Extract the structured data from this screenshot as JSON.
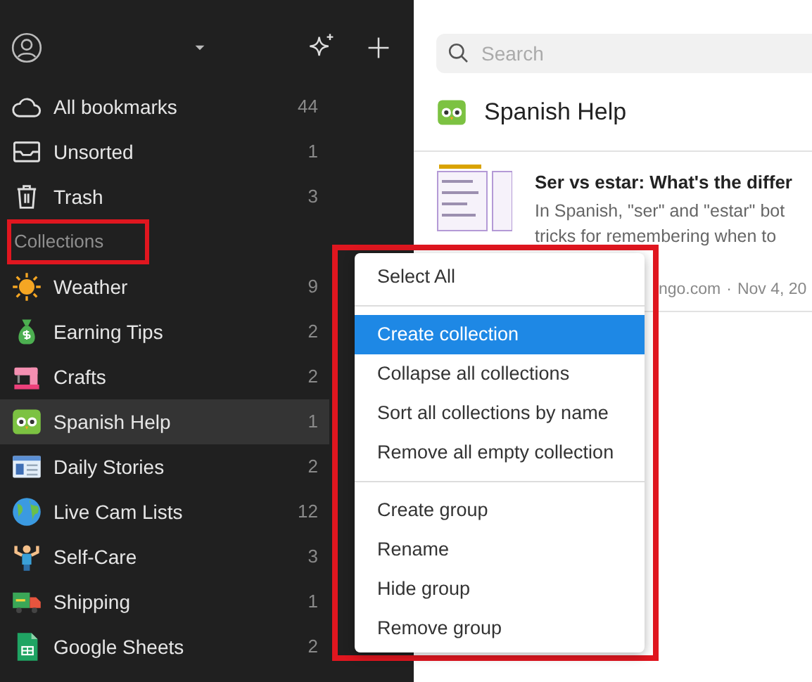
{
  "sidebar": {
    "system_items": [
      {
        "label": "All bookmarks",
        "count": "44"
      },
      {
        "label": "Unsorted",
        "count": "1"
      },
      {
        "label": "Trash",
        "count": "3"
      }
    ],
    "section_title": "Collections",
    "collections": [
      {
        "label": "Weather",
        "count": "9",
        "selected": false
      },
      {
        "label": "Earning Tips",
        "count": "2",
        "selected": false
      },
      {
        "label": "Crafts",
        "count": "2",
        "selected": false
      },
      {
        "label": "Spanish Help",
        "count": "1",
        "selected": true
      },
      {
        "label": "Daily Stories",
        "count": "2",
        "selected": false
      },
      {
        "label": "Live Cam Lists",
        "count": "12",
        "selected": false
      },
      {
        "label": "Self-Care",
        "count": "3",
        "selected": false
      },
      {
        "label": "Shipping",
        "count": "1",
        "selected": false
      },
      {
        "label": "Google Sheets",
        "count": "2",
        "selected": false
      }
    ]
  },
  "search": {
    "placeholder": "Search"
  },
  "collection_title": "Spanish Help",
  "bookmarks": [
    {
      "title": "Ser vs estar: What's the differ",
      "excerpt": [
        "In Spanish, \"ser\" and \"estar\" bot",
        "tricks for remembering when to"
      ],
      "source": "ngo.com",
      "separator": "·",
      "date": "Nov 4, 20"
    }
  ],
  "context_menu": {
    "groups": [
      [
        {
          "label": "Select All",
          "selected": false
        }
      ],
      [
        {
          "label": "Create collection",
          "selected": true
        },
        {
          "label": "Collapse all collections",
          "selected": false
        },
        {
          "label": "Sort all collections by name",
          "selected": false
        },
        {
          "label": "Remove all empty collection",
          "selected": false
        }
      ],
      [
        {
          "label": "Create group",
          "selected": false
        },
        {
          "label": "Rename",
          "selected": false
        },
        {
          "label": "Hide group",
          "selected": false
        },
        {
          "label": "Remove group",
          "selected": false
        }
      ]
    ]
  }
}
